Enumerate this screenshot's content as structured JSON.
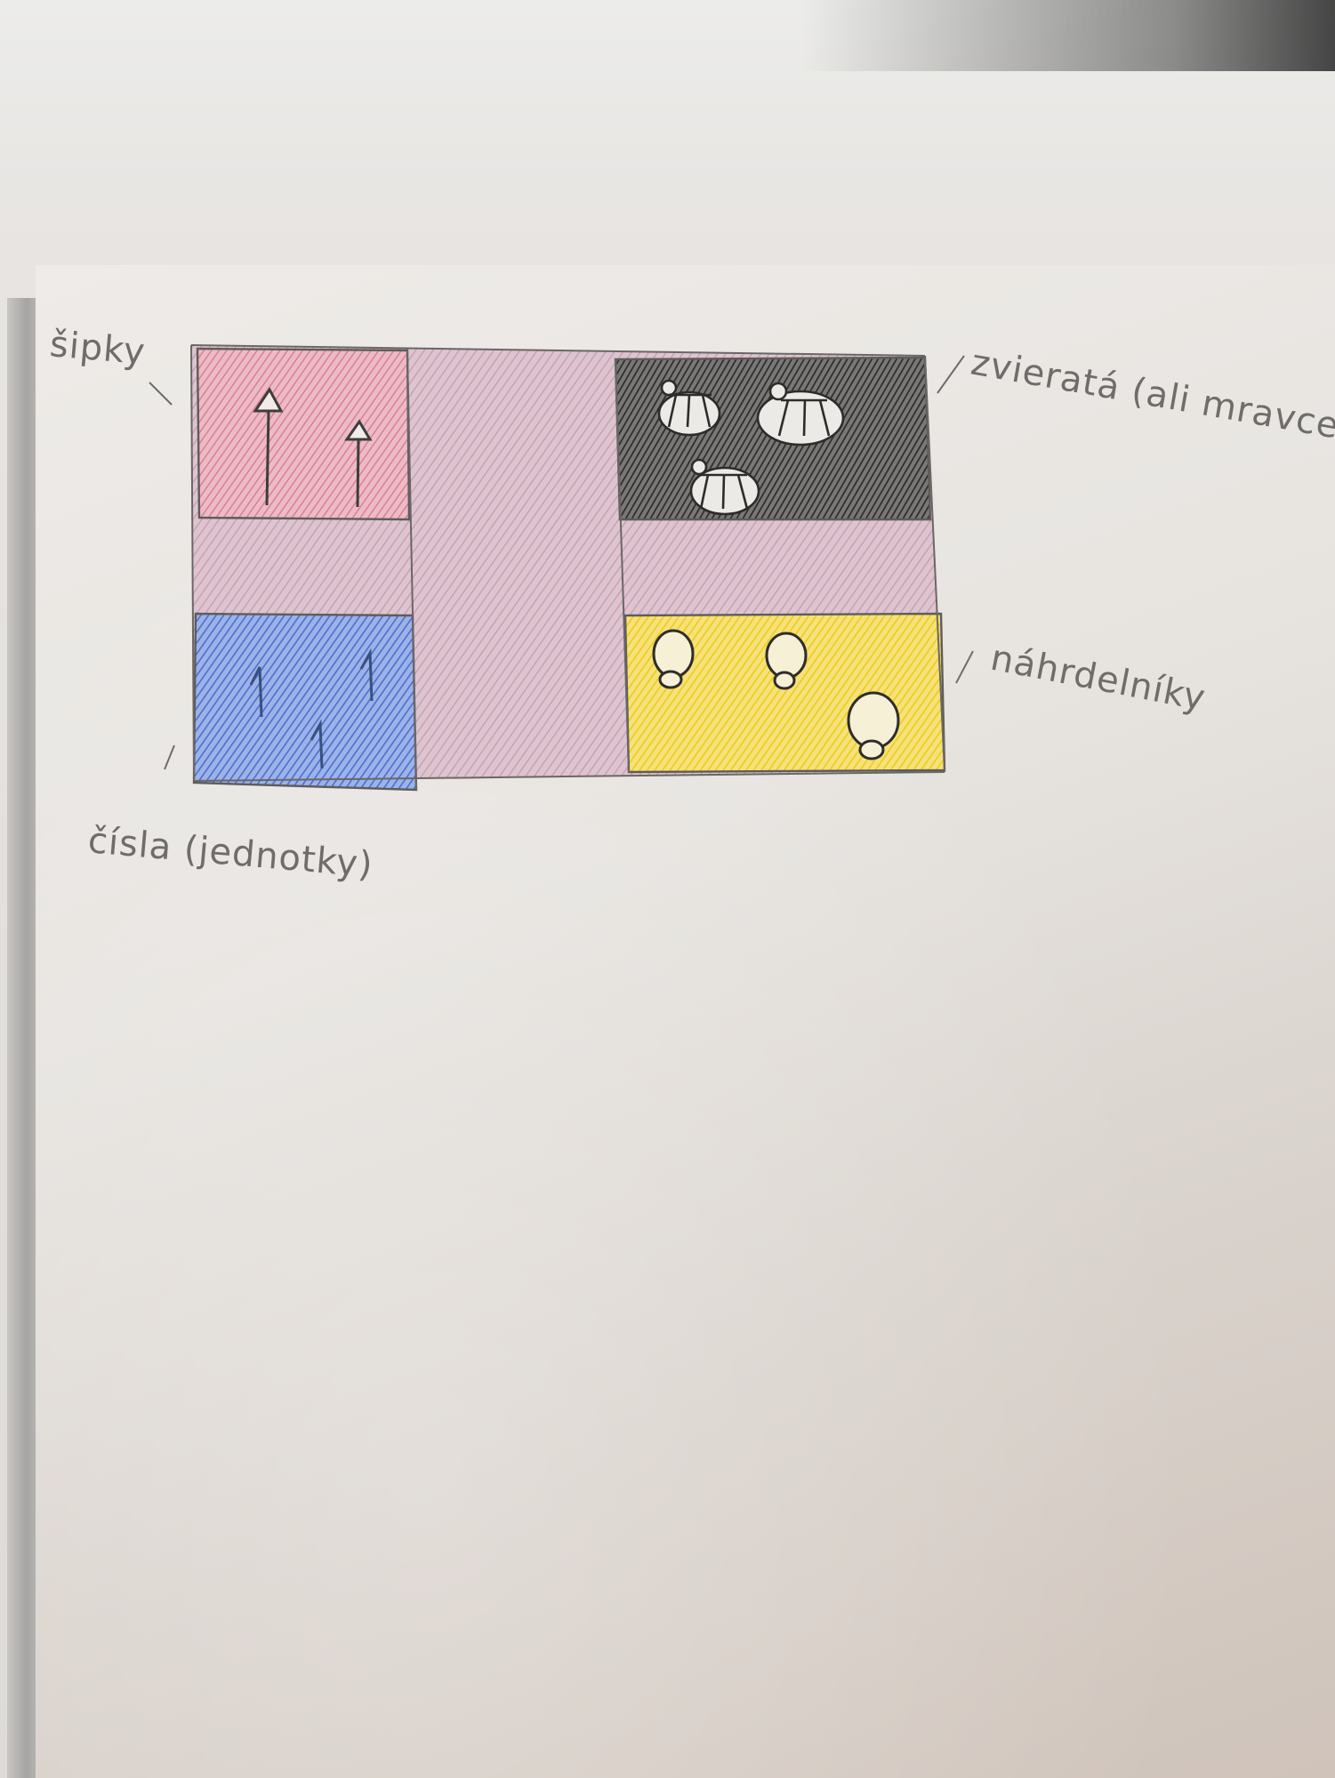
{
  "labels": {
    "arrows": "šipky",
    "animals": "zvieratá (ali mravce)",
    "necklaces": "náhrdelníky",
    "numbers": "čísla (jednotky)"
  },
  "colors": {
    "background": "#e9e6e3",
    "paper": "#e7e4e0",
    "pencil": "#5f5c5a",
    "cross": "#d6b8c6",
    "red_panel": "#e8a9b6",
    "black_panel": "#3a3a3a",
    "blue_panel": "#6f8fd6",
    "yellow_panel": "#f0d545"
  },
  "icons": {
    "red_panel": "arrow-up-icon",
    "black_panel": "ant-icon",
    "blue_panel": "digit-one-icon",
    "yellow_panel": "necklace-icon"
  }
}
